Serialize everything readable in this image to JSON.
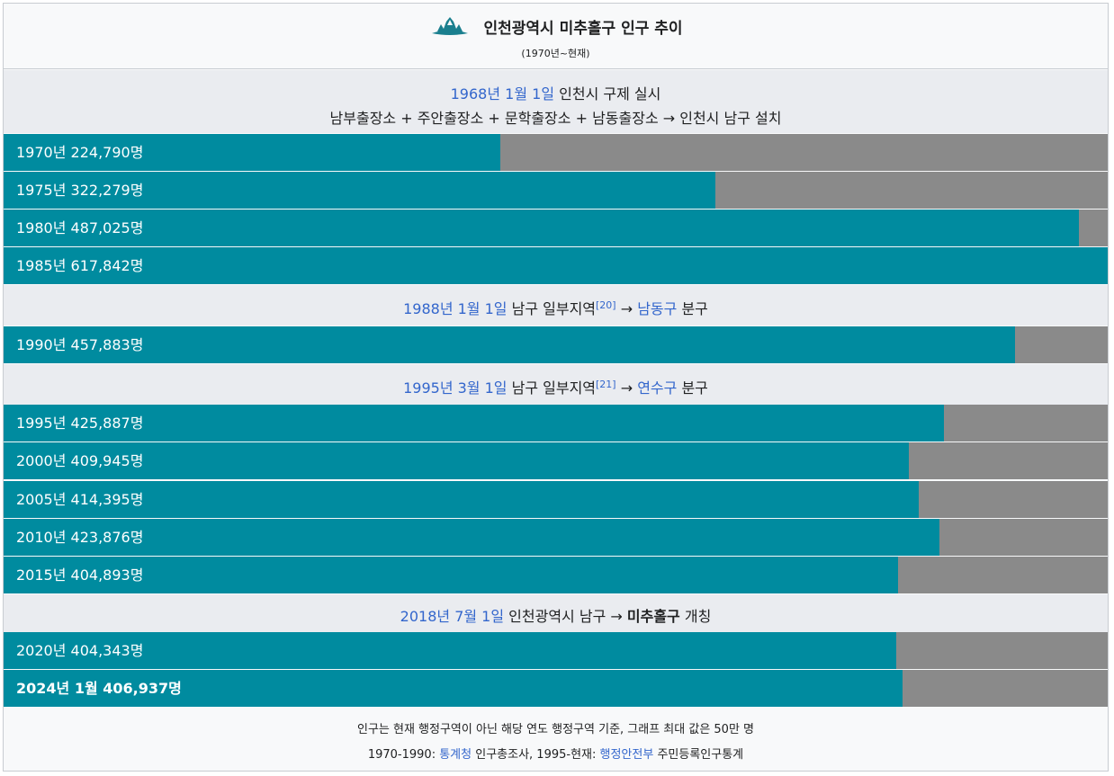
{
  "header": {
    "title": "인천광역시 미추홀구 인구 추이",
    "subtitle": "(1970년~현재)"
  },
  "events": [
    {
      "date": "1968년 1월 1일",
      "text": " 인천시 구제 실시",
      "line2": "남부출장소 + 주안출장소 + 문학출장소 + 남동출장소 → 인천시 남구 설치"
    },
    {
      "date": "1988년 1월 1일",
      "pre": " 남구 일부지역",
      "ref": "[20]",
      "arrow": " → ",
      "target": "남동구",
      "post": " 분구"
    },
    {
      "date": "1995년 3월 1일",
      "pre": " 남구 일부지역",
      "ref": "[21]",
      "arrow": " → ",
      "target": "연수구",
      "post": " 분구"
    },
    {
      "date": "2018년 7월 1일",
      "pre": " 인천광역시 남구 → ",
      "target": "미추홀구",
      "post": " 개칭"
    }
  ],
  "footer": {
    "line1": "인구는 현재 행정구역이 아닌 해당 연도 행정구역 기준, 그래프 최대 값은 50만 명",
    "src_a": "1970-1990: ",
    "link_a": "통계청",
    "src_b": " 인구총조사, 1995-현재: ",
    "link_b": "행정안전부",
    "src_c": " 주민등록인구통계"
  },
  "colors": {
    "bar": "#008b9f",
    "track": "#8a8a8a",
    "band": "#eaecf0",
    "link": "#3366cc"
  },
  "chart_data": {
    "type": "bar",
    "orientation": "horizontal",
    "xlim": [
      0,
      500000
    ],
    "categories": [
      "1970년",
      "1975년",
      "1980년",
      "1985년",
      "1990년",
      "1995년",
      "2000년",
      "2005년",
      "2010년",
      "2015년",
      "2020년",
      "2024년 1월"
    ],
    "values": [
      224790,
      322279,
      487025,
      617842,
      457883,
      425887,
      409945,
      414395,
      423876,
      404893,
      404343,
      406937
    ],
    "labels": [
      "1970년 224,790명",
      "1975년 322,279명",
      "1980년 487,025명",
      "1985년 617,842명",
      "1990년 457,883명",
      "1995년 425,887명",
      "2000년 409,945명",
      "2005년 414,395명",
      "2010년 423,876명",
      "2015년 404,893명",
      "2020년 404,343명",
      "2024년 1월 406,937명"
    ]
  }
}
